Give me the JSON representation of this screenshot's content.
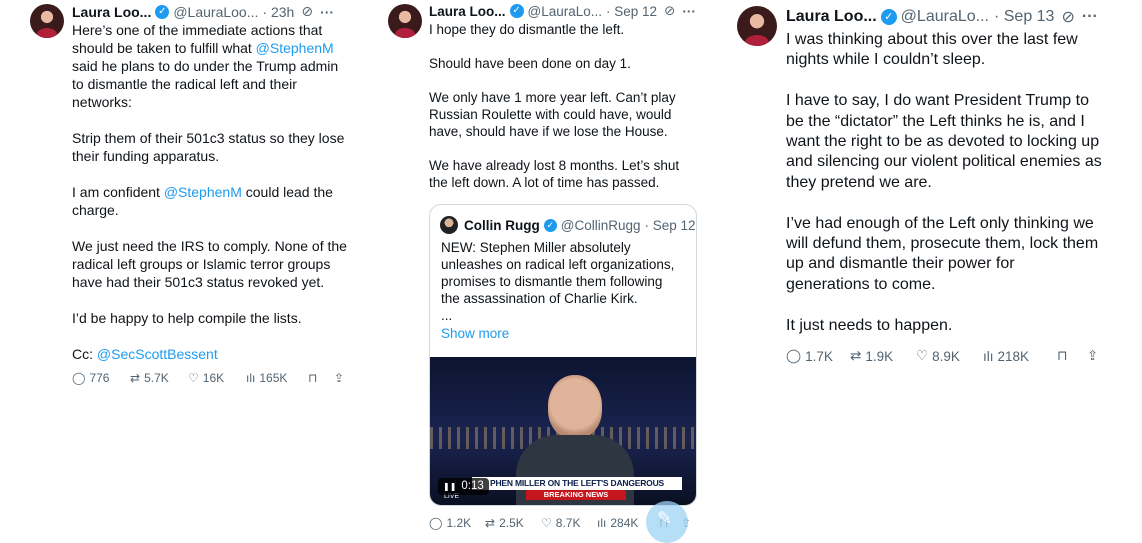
{
  "tweets": [
    {
      "author": "Laura Loo...",
      "handle": "@LauraLoo...",
      "time": "· 23h",
      "lines": [
        {
          "text": "Here’s one of the immediate actions that\nshould be taken to fulfill what ",
          "mention": "@StephenM"
        },
        {
          "text": "\nsaid he plans to do under the Trump admin\nto dismantle the radical left and their\nnetworks:\n\nStrip them of their 501c3 status so they lose\ntheir funding apparatus.\n\nI am confident ",
          "mention": "@StephenM"
        },
        {
          "text": " could lead the\ncharge.\n\nWe just need the IRS to comply. None of the\nradical left groups or Islamic terror groups\nhave had their 501c3 status revoked yet.\n\nI’d be happy to help compile the lists.\n\nCc: ",
          "mention": "@SecScottBessent"
        }
      ],
      "stats": {
        "replies": "776",
        "reposts": "5.7K",
        "likes": "16K",
        "views": "165K"
      }
    },
    {
      "author": "Laura Loo...",
      "handle": "@LauraLo...",
      "time": "· Sep 12",
      "text": "I hope they do dismantle the left.\n\nShould have been done on day 1.\n\nWe only have 1 more year left. Can’t play\nRussian Roulette with could have, would\nhave, should have if we lose the House.\n\nWe have already lost 8 months. Let’s shut\nthe left down. A lot of time has passed.",
      "quote": {
        "author": "Collin Rugg",
        "handle": "@CollinRugg",
        "time": "· Sep 12",
        "text": "NEW: Stephen Miller absolutely\nunleashes on radical left organizations,\npromises to dismantle them following\nthe assassination of Charlie Kirk.\n...",
        "show_more": "Show more",
        "video": {
          "time": "0:13",
          "chyron": "PHEN MILLER ON THE LEFT'S DANGEROUS RHETORIC",
          "breaking": "BREAKING NEWS",
          "live": "LIVE"
        }
      },
      "stats": {
        "replies": "1.2K",
        "reposts": "2.5K",
        "likes": "8.7K",
        "views": "284K"
      }
    },
    {
      "author": "Laura Loo...",
      "handle": "@LauraLo...",
      "time": "· Sep 13",
      "text": "I was thinking about this over the last few\nnights while I couldn’t sleep.\n\nI have to say, I do want President Trump to\nbe the “dictator” the Left thinks he is, and I\nwant the right to be as devoted to locking up\nand silencing our violent political enemies as\nthey pretend we are.\n\nI’ve had enough of the Left only thinking we\nwill defund them, prosecute them, lock them\nup and dismantle their power for\ngenerations to come.\n\nIt just needs to happen.",
      "stats": {
        "replies": "1.7K",
        "reposts": "1.9K",
        "likes": "8.9K",
        "views": "218K"
      }
    }
  ],
  "icons": {
    "verified": "✓",
    "grok": "⊘",
    "more": "···",
    "reply": "◯",
    "repost": "⇄",
    "like": "♡",
    "views": "ılı",
    "bookmark": "⊓",
    "share": "⇪",
    "play": "❚❚",
    "compose": "✎"
  },
  "colors": {
    "accent": "#1d9bf0",
    "text": "#0f1419",
    "muted": "#536471",
    "breaking": "#c4161c"
  }
}
